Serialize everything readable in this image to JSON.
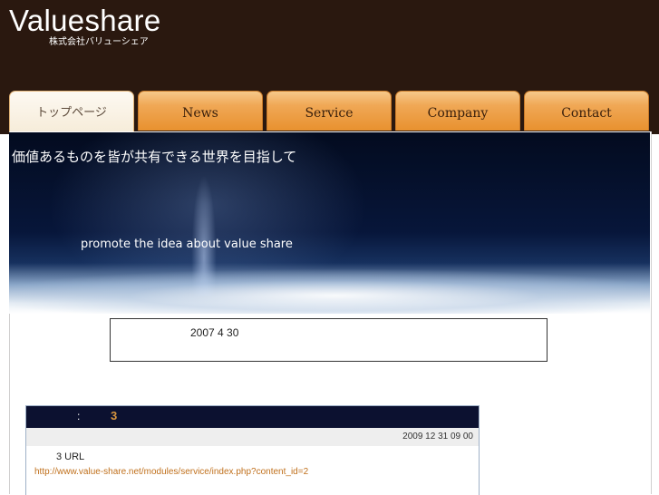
{
  "brand": {
    "title": "Valueshare",
    "subtitle": "株式会社バリューシェア"
  },
  "nav": {
    "tabs": [
      {
        "label": "トップページ",
        "active": true
      },
      {
        "label": "News",
        "active": false
      },
      {
        "label": "Service",
        "active": false
      },
      {
        "label": "Company",
        "active": false
      },
      {
        "label": "Contact",
        "active": false
      }
    ]
  },
  "banner": {
    "title": "価値あるものを皆が共有できる世界を目指して",
    "tagline": "promote the idea about value share"
  },
  "notice": {
    "date": "2007 4 30"
  },
  "news": {
    "colon": ":",
    "count": "3",
    "datetime": "2009 12 31  09 00",
    "body": "3    URL",
    "link": "http://www.value-share.net/modules/service/index.php?content_id=2"
  },
  "colors": {
    "header_bg": "#2a180f",
    "tab_orange": "#f0a856",
    "news_head_bg": "#0c1130",
    "accent": "#d8953e",
    "link": "#c0701c"
  }
}
